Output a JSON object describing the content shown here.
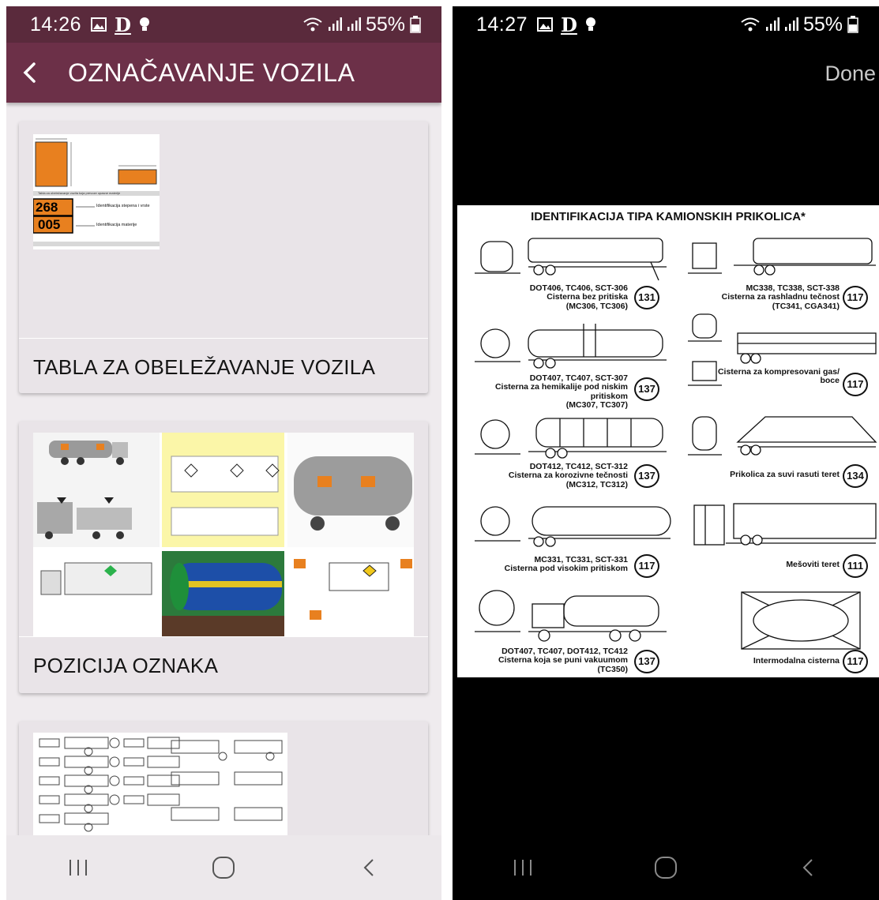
{
  "left": {
    "status": {
      "time": "14:26",
      "battery": "55%"
    },
    "title": "OZNAČAVANJE VOZILA",
    "cards": [
      {
        "label": "TABLA ZA OBELEŽAVANJE VOZILA",
        "thumb": {
          "tab_caption": "Tabla za obeležavanje vozila koja prevoze opasne materije",
          "code_top": "268",
          "code_bottom": "005",
          "row1": "Identifikacija stepena i vrste",
          "row2": "Identifikacija materije"
        }
      },
      {
        "label": "POZICIJA OZNAKA"
      },
      {
        "label": ""
      }
    ]
  },
  "right": {
    "status": {
      "time": "14:27",
      "battery": "55%"
    },
    "done": "Done",
    "document": {
      "title": "IDENTIFIKACIJA TIPA KAMIONSKIH PRIKOLICA*",
      "entries": [
        {
          "lines": [
            "DOT406, TC406, SCT-306",
            "Cisterna bez pritiska",
            "(MC306, TC306)"
          ],
          "number": "131"
        },
        {
          "lines": [
            "MC338, TC338, SCT-338",
            "Cisterna za rashladnu tečnost",
            "(TC341, CGA341)"
          ],
          "number": "117"
        },
        {
          "lines": [
            "DOT407, TC407, SCT-307",
            "Cisterna za hemikalije pod niskim pritiskom",
            "(MC307, TC307)"
          ],
          "number": "137"
        },
        {
          "lines": [
            "Cisterna za kompresovani gas/",
            "boce"
          ],
          "number": "117"
        },
        {
          "lines": [
            "DOT412, TC412, SCT-312",
            "Cisterna za korozivne tečnosti",
            "(MC312, TC312)"
          ],
          "number": "137"
        },
        {
          "lines": [
            "Prikolica za suvi rasuti teret"
          ],
          "number": "134"
        },
        {
          "lines": [
            "MC331, TC331, SCT-331",
            "Cisterna pod visokim pritiskom"
          ],
          "number": "117"
        },
        {
          "lines": [
            "Mešoviti teret"
          ],
          "number": "111"
        },
        {
          "lines": [
            "DOT407, TC407, DOT412, TC412",
            "Cisterna koja se puni vakuumom",
            "(TC350)"
          ],
          "number": "137"
        },
        {
          "lines": [
            "Intermodalna cisterna"
          ],
          "number": "117"
        }
      ]
    }
  },
  "icons": {
    "status_left": [
      "image-icon",
      "d-app-icon",
      "bulb-icon"
    ],
    "status_right": [
      "wifi-icon",
      "signal-icon",
      "signal-icon",
      "battery-icon"
    ],
    "nav": [
      "recent-apps-icon",
      "home-icon",
      "back-icon"
    ]
  },
  "colors": {
    "statusbar": "#5a2a3c",
    "appbar": "#6c3048",
    "background": "#efebee",
    "card": "#e9e4e8",
    "placard": "#e8801f"
  }
}
